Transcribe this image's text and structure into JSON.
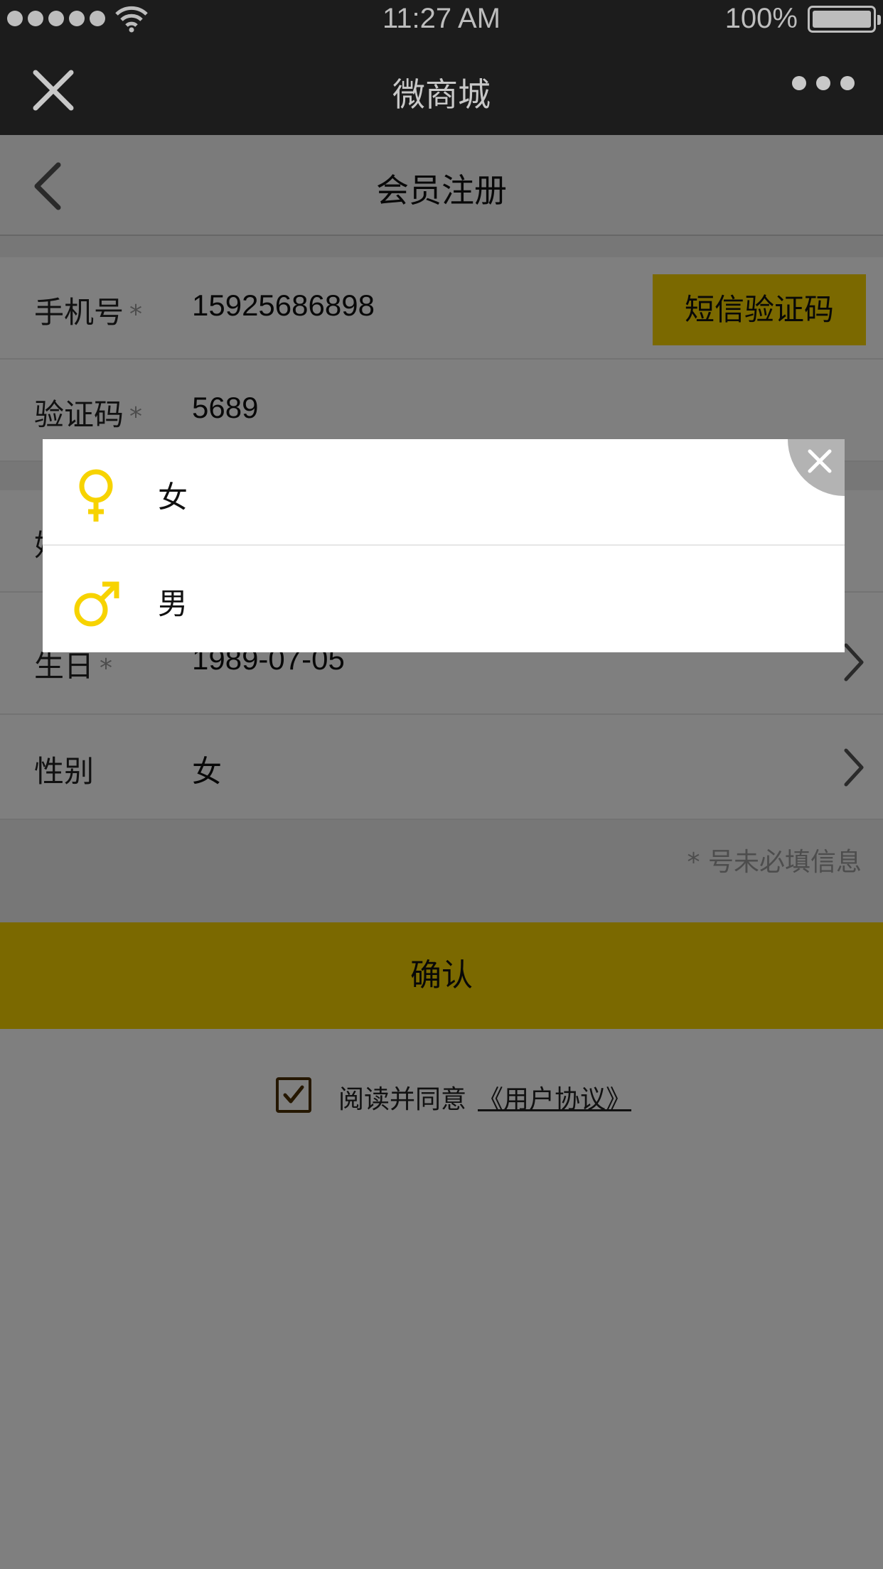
{
  "status_bar": {
    "time": "11:27 AM",
    "battery": "100%"
  },
  "app_bar": {
    "title": "微商城"
  },
  "header": {
    "title": "会员注册"
  },
  "form": {
    "phone": {
      "label": "手机号",
      "required_mark": "*",
      "value": "15925686898",
      "sms_button": "短信验证码"
    },
    "code": {
      "label": "验证码",
      "required_mark": "*",
      "value": "5689"
    },
    "name": {
      "label_partial": "姓"
    },
    "birthday": {
      "label": "生日",
      "required_mark": "*",
      "value": "1989-07-05"
    },
    "gender": {
      "label": "性别",
      "value": "女"
    }
  },
  "hint": "*  号未必填信息",
  "confirm_button": "确认",
  "agreement": {
    "text": "阅读并同意",
    "link": "《用户协议》",
    "checked": true
  },
  "gender_dialog": {
    "options": [
      {
        "label": "女",
        "icon": "female-icon"
      },
      {
        "label": "男",
        "icon": "male-icon"
      }
    ],
    "icon_color": "#f7d300"
  },
  "colors": {
    "accent": "#f7d300",
    "bar_bg": "#1c1c1c"
  }
}
